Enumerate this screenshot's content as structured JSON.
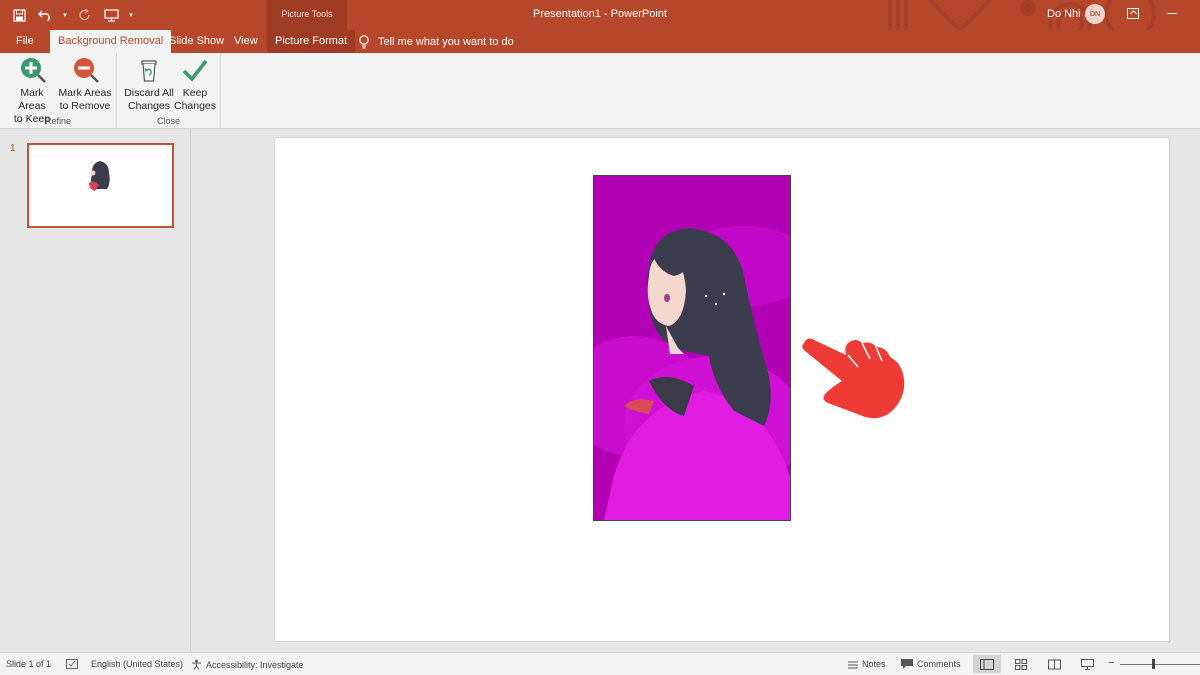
{
  "app": {
    "title": "Presentation1  -  PowerPoint",
    "context_header": "Picture Tools",
    "user_name": "Do Nhi",
    "user_initials": "DN"
  },
  "quick_access": {
    "icons": [
      "save-icon",
      "undo-icon",
      "redo-icon",
      "start-slideshow-icon",
      "customize-qat-icon"
    ]
  },
  "tabs": [
    {
      "label": "File",
      "active": false
    },
    {
      "label": "Background Removal",
      "active": true
    },
    {
      "label": "Slide Show",
      "active": false
    },
    {
      "label": "View",
      "active": false
    },
    {
      "label": "Picture Format",
      "active": false
    }
  ],
  "tell_me": {
    "label": "Tell me what you want to do"
  },
  "ribbon": {
    "groups": [
      {
        "label": "Refine",
        "buttons": [
          {
            "line1": "Mark Areas",
            "line2": "to Keep",
            "icon": "mark-keep-icon"
          },
          {
            "line1": "Mark Areas",
            "line2": "to Remove",
            "icon": "mark-remove-icon"
          }
        ]
      },
      {
        "label": "Close",
        "buttons": [
          {
            "line1": "Discard All",
            "line2": "Changes",
            "icon": "discard-icon"
          },
          {
            "line1": "Keep",
            "line2": "Changes",
            "icon": "checkmark-icon"
          }
        ]
      }
    ]
  },
  "thumbnails": {
    "slide_number": "1"
  },
  "status": {
    "slide": "Slide 1 of 1",
    "language": "English (United States)",
    "accessibility": "Accessibility: Investigate",
    "notes": "Notes",
    "comments": "Comments"
  },
  "colors": {
    "brand": "#b7472a",
    "removal_overlay": "#b200b5",
    "pointer": "#ef3b36"
  }
}
